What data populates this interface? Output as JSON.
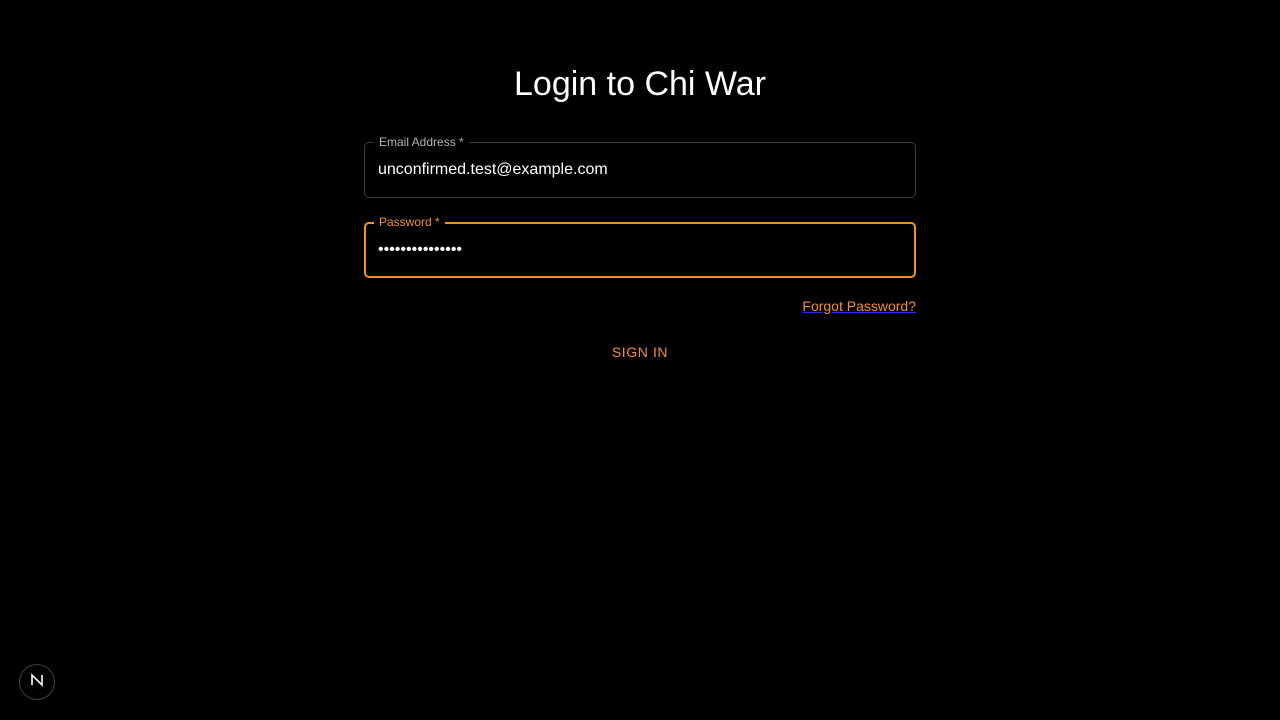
{
  "page": {
    "title": "Login to Chi War"
  },
  "form": {
    "email": {
      "label": "Email Address *",
      "value": "unconfirmed.test@example.com",
      "type": "email"
    },
    "password": {
      "label": "Password *",
      "value": "•••••••••••••••",
      "type": "password",
      "focused": true
    },
    "forgot_link": "Forgot Password?",
    "submit_label": "SIGN IN"
  },
  "dev_indicator": {
    "icon": "nextjs-logo-icon"
  },
  "colors": {
    "background": "#000000",
    "accent": "#f5911e",
    "text": "#ffffff",
    "muted_label": "#b3b3b3",
    "border": "#3a3a3a"
  }
}
